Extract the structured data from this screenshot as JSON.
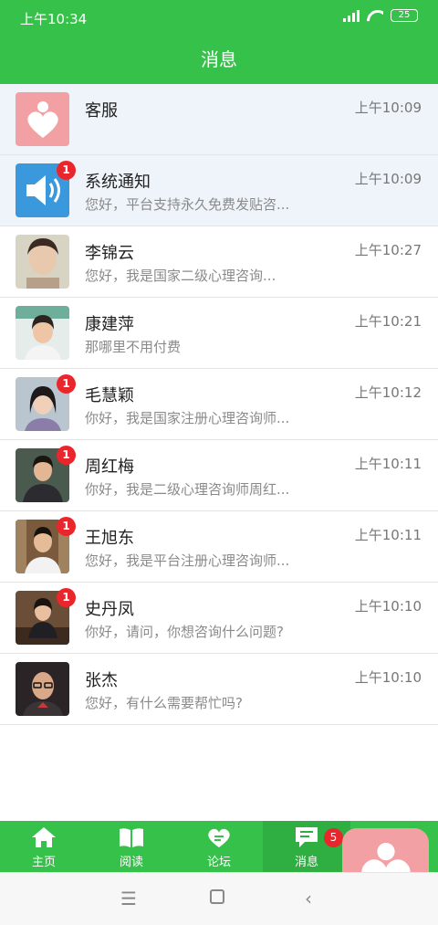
{
  "status_bar": {
    "time": "上午10:34",
    "battery": "25"
  },
  "header": {
    "title": "消息"
  },
  "conversations": [
    {
      "name": "客服",
      "time": "上午10:09",
      "preview": "",
      "badge": ""
    },
    {
      "name": "系统通知",
      "time": "上午10:09",
      "preview": "您好，平台支持永久免费发贴咨...",
      "badge": "1"
    },
    {
      "name": "李锦云",
      "time": "上午10:27",
      "preview": " 您好，我是国家二级心理咨询...",
      "badge": ""
    },
    {
      "name": "康建萍",
      "time": "上午10:21",
      "preview": "那哪里不用付费",
      "badge": ""
    },
    {
      "name": "毛慧颖",
      "time": "上午10:12",
      "preview": "你好，我是国家注册心理咨询师...",
      "badge": "1"
    },
    {
      "name": "周红梅",
      "time": "上午10:11",
      "preview": "你好，我是二级心理咨询师周红...",
      "badge": "1"
    },
    {
      "name": "王旭东",
      "time": "上午10:11",
      "preview": "您好，我是平台注册心理咨询师...",
      "badge": "1"
    },
    {
      "name": "史丹凤",
      "time": "上午10:10",
      "preview": "你好，请问，你想咨询什么问题?",
      "badge": "1"
    },
    {
      "name": "张杰",
      "time": "上午10:10",
      "preview": "您好，有什么需要帮忙吗?",
      "badge": ""
    }
  ],
  "tabbar": {
    "home": "主页",
    "read": "阅读",
    "forum": "论坛",
    "messages": "消息",
    "messages_badge": "5"
  },
  "colors": {
    "brand_green": "#36c24a",
    "badge_red": "#e8262b",
    "logo_pink": "#f2a0a4"
  }
}
